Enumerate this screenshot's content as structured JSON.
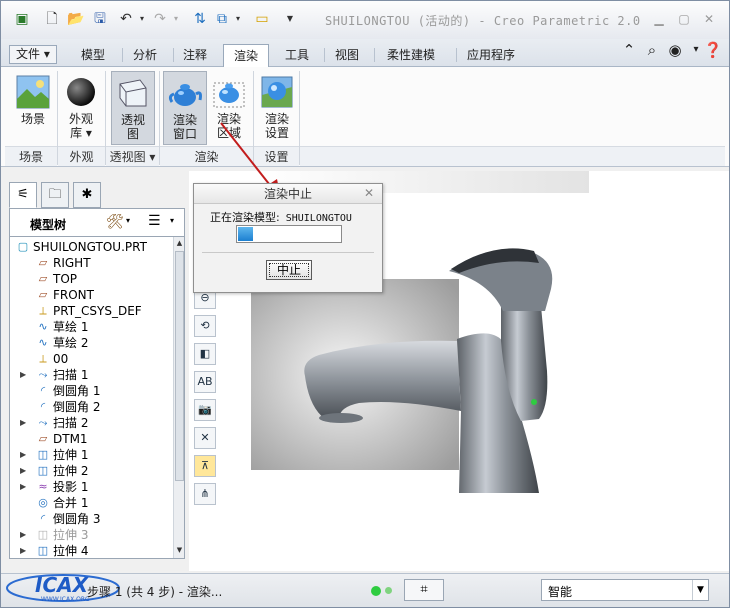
{
  "window": {
    "title": "SHUILONGTOU (活动的) - Creo Parametric 2.0"
  },
  "quick_access": {
    "icons": [
      "app-icon",
      "new-icon",
      "open-icon",
      "save-icon",
      "undo-icon",
      "redo-icon",
      "regenerate-icon",
      "windows-icon",
      "close-window-icon",
      "customize-icon"
    ]
  },
  "tabs": {
    "file": "文件",
    "items": [
      "模型",
      "分析",
      "注释",
      "渲染",
      "工具",
      "视图",
      "柔性建模",
      "应用程序"
    ],
    "active": "渲染"
  },
  "ribbon": {
    "buttons": [
      {
        "label1": "场景",
        "label2": ""
      },
      {
        "label1": "外观",
        "label2": "库 ▾"
      },
      {
        "label1": "透视",
        "label2": "图"
      },
      {
        "label1": "渲染",
        "label2": "窗口"
      },
      {
        "label1": "渲染",
        "label2": "区域"
      },
      {
        "label1": "渲染",
        "label2": "设置"
      }
    ],
    "groups": [
      "场景",
      "外观",
      "透视图 ▾",
      "渲染",
      "设置"
    ]
  },
  "model_tree": {
    "title": "模型树",
    "items": [
      {
        "label": "SHUILONGTOU.PRT",
        "icon": "part-icon",
        "expand": ""
      },
      {
        "label": "RIGHT",
        "icon": "datum-plane-icon",
        "expand": ""
      },
      {
        "label": "TOP",
        "icon": "datum-plane-icon",
        "expand": ""
      },
      {
        "label": "FRONT",
        "icon": "datum-plane-icon",
        "expand": ""
      },
      {
        "label": "PRT_CSYS_DEF",
        "icon": "csys-icon",
        "expand": ""
      },
      {
        "label": "草绘 1",
        "icon": "sketch-icon",
        "expand": ""
      },
      {
        "label": "草绘 2",
        "icon": "sketch-icon",
        "expand": ""
      },
      {
        "label": "00",
        "icon": "csys-icon",
        "expand": ""
      },
      {
        "label": "扫描 1",
        "icon": "sweep-icon",
        "expand": "▶"
      },
      {
        "label": "倒圆角 1",
        "icon": "round-icon",
        "expand": ""
      },
      {
        "label": "倒圆角 2",
        "icon": "round-icon",
        "expand": ""
      },
      {
        "label": "扫描 2",
        "icon": "sweep-icon",
        "expand": "▶"
      },
      {
        "label": "DTM1",
        "icon": "datum-plane-icon",
        "expand": ""
      },
      {
        "label": "拉伸 1",
        "icon": "extrude-icon",
        "expand": "▶"
      },
      {
        "label": "拉伸 2",
        "icon": "extrude-icon",
        "expand": "▶"
      },
      {
        "label": "投影 1",
        "icon": "project-icon",
        "expand": "▶"
      },
      {
        "label": "合并 1",
        "icon": "merge-icon",
        "expand": ""
      },
      {
        "label": "倒圆角 3",
        "icon": "round-icon",
        "expand": ""
      },
      {
        "label": "拉伸 3",
        "icon": "extrude-icon",
        "expand": "▶",
        "dim": true
      },
      {
        "label": "拉伸 4",
        "icon": "extrude-icon",
        "expand": "▶"
      }
    ]
  },
  "dialog": {
    "title": "渲染中止",
    "message": "正在渲染模型:",
    "model_name": "SHUILONGTOU",
    "progress": 0.15,
    "abort_label": "中止"
  },
  "statusbar": {
    "text": "步骤 1 (共 4 步) - 渲染...",
    "logo_text": "ICAX",
    "logo_sub": "WWW.ICAX.ORG",
    "filter_value": "智能",
    "status_colors": [
      "#2ecc40",
      "#7fd37f"
    ]
  },
  "graphics_toolbar": {
    "icons": [
      "zoom-in-icon",
      "zoom-out-icon",
      "repaint-icon",
      "display-style-icon",
      "saved-views-icon",
      "view-manager-icon",
      "datum-display-icon",
      "spin-center-icon",
      "annotation-display-icon"
    ]
  }
}
